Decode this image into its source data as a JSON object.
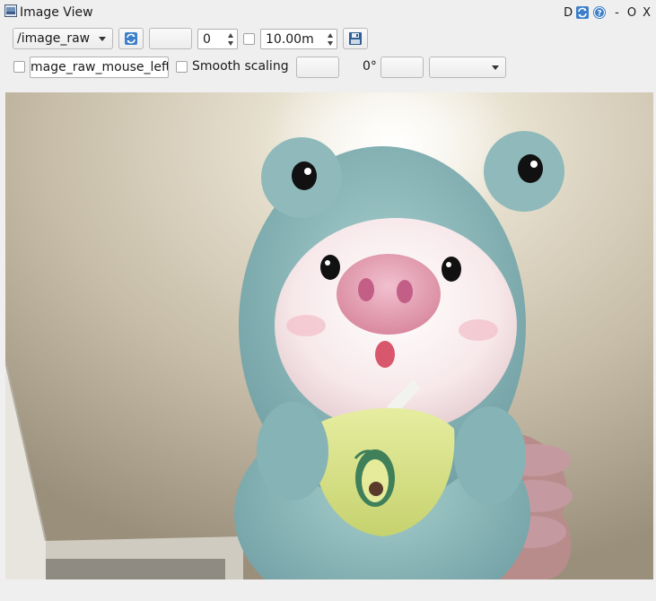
{
  "window": {
    "title": "Image View",
    "title_letter": "D",
    "controls": [
      "-",
      "O",
      "X"
    ]
  },
  "toolbar": {
    "topic_selected": "/image_raw",
    "topic_options": [
      "/image_raw"
    ],
    "rotation_spin_value": "0",
    "dynamic_range_value": "10.00m",
    "mouse_topic_value": "mage_raw_mouse_left",
    "smooth_scaling_label": "Smooth scaling",
    "rotation_label": "0°",
    "smooth_scaling_checked": false,
    "dynamic_range_checked": false,
    "publish_mouse_checked": false
  },
  "image": {
    "description_icon": "camera-image"
  }
}
